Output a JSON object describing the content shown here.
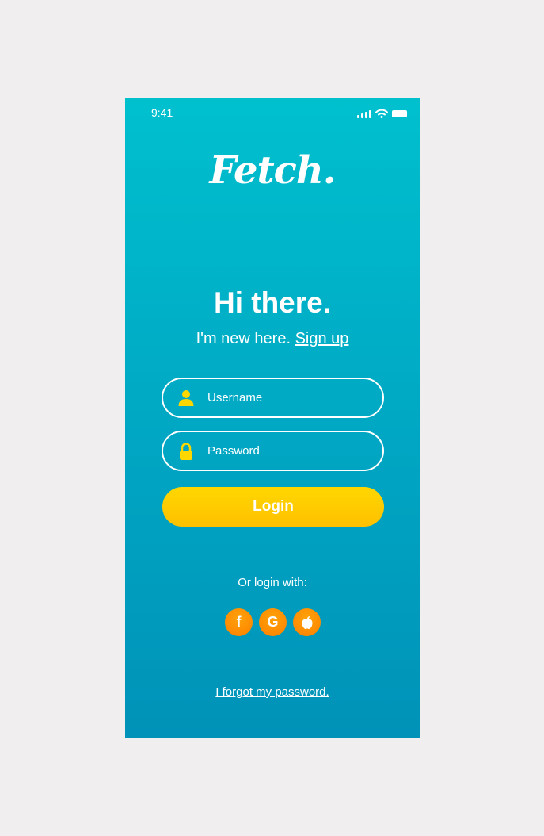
{
  "status_bar": {
    "time": "9:41",
    "icons": [
      "signal-icon",
      "wifi-icon",
      "battery-icon"
    ]
  },
  "logo": {
    "text": "Fetch."
  },
  "headline": "Hi there.",
  "signup": {
    "prefix": "I'm new here.",
    "link_label": "Sign up"
  },
  "form": {
    "username": {
      "placeholder": "Username",
      "value": "",
      "icon": "user-icon"
    },
    "password": {
      "placeholder": "Password",
      "value": "",
      "icon": "lock-icon"
    },
    "login_label": "Login"
  },
  "social_login": {
    "label": "Or login with:",
    "providers": [
      {
        "name": "facebook",
        "glyph": "f",
        "icon": "facebook-icon"
      },
      {
        "name": "google",
        "glyph": "G",
        "icon": "google-icon"
      },
      {
        "name": "apple",
        "icon": "apple-icon"
      }
    ]
  },
  "forgot_password": "I forgot my password.",
  "colors": {
    "background": "#f1eeef",
    "gradient_top": "#00c0ce",
    "gradient_bottom": "#0092b8",
    "login_button": "#ffc800",
    "social_button": "#ff8a00",
    "input_icon": "#ffd700",
    "text": "#ffffff"
  }
}
